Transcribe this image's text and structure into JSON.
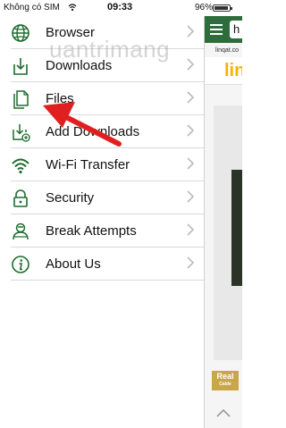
{
  "status_bar": {
    "carrier": "Không có SIM",
    "time": "09:33",
    "battery": "96%",
    "battery_level": 0.96
  },
  "menu": {
    "items": [
      {
        "label": "Browser",
        "icon": "globe-icon"
      },
      {
        "label": "Downloads",
        "icon": "download-icon"
      },
      {
        "label": "Files",
        "icon": "files-icon"
      },
      {
        "label": "Add Downloads",
        "icon": "add-download-icon"
      },
      {
        "label": "Wi-Fi Transfer",
        "icon": "wifi-icon"
      },
      {
        "label": "Security",
        "icon": "lock-icon"
      },
      {
        "label": "Break Attempts",
        "icon": "intruder-icon"
      },
      {
        "label": "About Us",
        "icon": "info-icon"
      }
    ]
  },
  "watermark": "uantrimang",
  "browser_pane": {
    "url_partial": "h",
    "site_text": "linqat.co",
    "logo_partial": "lin",
    "tag_text": "Real",
    "tag_sub": "Cable"
  },
  "colors": {
    "icon_green": "#1e6b2f",
    "pane_header": "#2e6c3b",
    "arrow_red": "#e02020",
    "logo_yellow": "#f5b400"
  }
}
